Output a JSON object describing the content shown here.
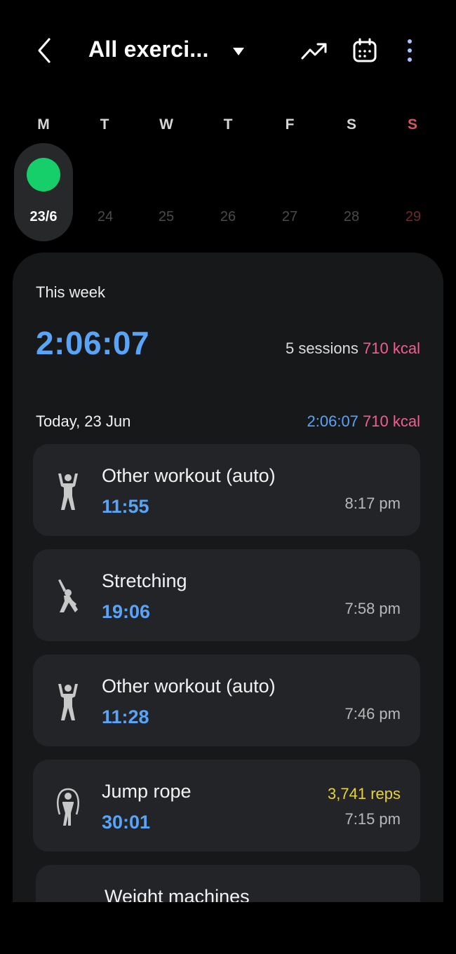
{
  "header": {
    "title": "All exerci...",
    "icons": [
      "back-arrow-icon",
      "dropdown-triangle-icon",
      "trend-chart-icon",
      "calendar-icon",
      "more-vert-icon"
    ]
  },
  "week": {
    "days": [
      {
        "letter": "M",
        "num": "23/6"
      },
      {
        "letter": "T",
        "num": "24"
      },
      {
        "letter": "W",
        "num": "25"
      },
      {
        "letter": "T",
        "num": "26"
      },
      {
        "letter": "F",
        "num": "27"
      },
      {
        "letter": "S",
        "num": "28"
      },
      {
        "letter": "S",
        "num": "29"
      }
    ],
    "selected_index": 0,
    "dot_color": "#17cf6a",
    "sunday_color": "#d8565c"
  },
  "summary": {
    "label": "This week",
    "total_time": "2:06:07",
    "sessions_count": "5",
    "sessions_word": "sessions",
    "kcal_value": "710",
    "kcal_unit": "kcal"
  },
  "today": {
    "label": "Today, 23 Jun",
    "time": "2:06:07",
    "kcal": "710 kcal"
  },
  "workouts": [
    {
      "title": "Other workout (auto)",
      "duration": "11:55",
      "time": "8:17 pm",
      "icon": "other-workout-icon"
    },
    {
      "title": "Stretching",
      "duration": "19:06",
      "time": "7:58 pm",
      "icon": "stretching-icon"
    },
    {
      "title": "Other workout (auto)",
      "duration": "11:28",
      "time": "7:46 pm",
      "icon": "other-workout-icon"
    },
    {
      "title": "Jump rope",
      "duration": "30:01",
      "time": "7:15 pm",
      "reps": "3,741 reps",
      "icon": "jump-rope-icon"
    },
    {
      "title": "Weight machines",
      "icon": "weight-machines-icon"
    }
  ],
  "colors": {
    "accent_blue": "#5aa4f7",
    "kcal_pink": "#f45d92",
    "reps_yellow": "#e6d33b",
    "panel_bg": "#17181a",
    "card_bg": "#232427"
  }
}
